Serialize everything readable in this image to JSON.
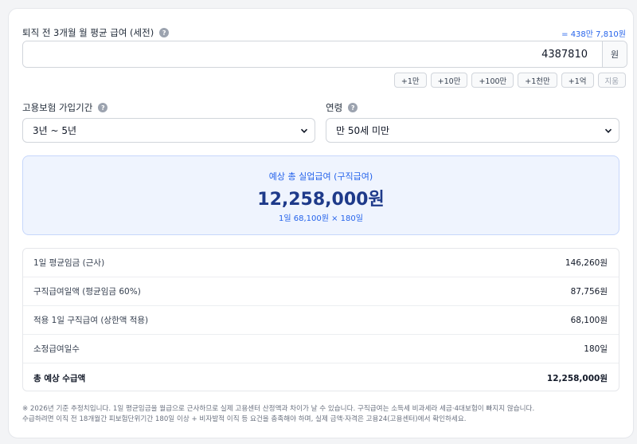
{
  "salary": {
    "label": "퇴직 전 3개월 월 평균 급여 (세전)",
    "converted": "= 438만 7,810원",
    "value": "4387810",
    "unit": "원"
  },
  "quick_buttons": [
    "+1만",
    "+10만",
    "+100만",
    "+1천만",
    "+1억"
  ],
  "clear_label": "지움",
  "insurance_period": {
    "label": "고용보험 가입기간",
    "selected": "3년 ~ 5년"
  },
  "age": {
    "label": "연령",
    "selected": "만 50세 미만"
  },
  "result": {
    "title": "예상 총 실업급여 (구직급여)",
    "amount": "12,258,000원",
    "formula": "1일 68,100원 × 180일"
  },
  "breakdown": [
    {
      "label": "1일 평균임금 (근사)",
      "value": "146,260원"
    },
    {
      "label": "구직급여일액 (평균임금 60%)",
      "value": "87,756원"
    },
    {
      "label": "적용 1일 구직급여 (상한액 적용)",
      "value": "68,100원"
    },
    {
      "label": "소정급여일수",
      "value": "180일"
    },
    {
      "label": "총 예상 수급액",
      "value": "12,258,000원"
    }
  ],
  "note_line1": "※ 2026년 기준 추정치입니다. 1일 평균임금을 월급으로 근사하므로 실제 고용센터 산정액과 차이가 날 수 있습니다. 구직급여는 소득세 비과세라 세금·4대보험이 빠지지 않습니다.",
  "note_line2": "수급하려면 이직 전 18개월간 피보험단위기간 180일 이상 + 비자발적 이직 등 요건을 충족해야 하며, 실제 금액·자격은 고용24(고용센터)에서 확인하세요.",
  "colors": {
    "accent": "#2563eb",
    "amount": "#1e3a8a",
    "result_bg": "#eff4fe"
  },
  "icons": {
    "help": "question-circle-icon",
    "dropdown": "chevron-down-icon"
  }
}
